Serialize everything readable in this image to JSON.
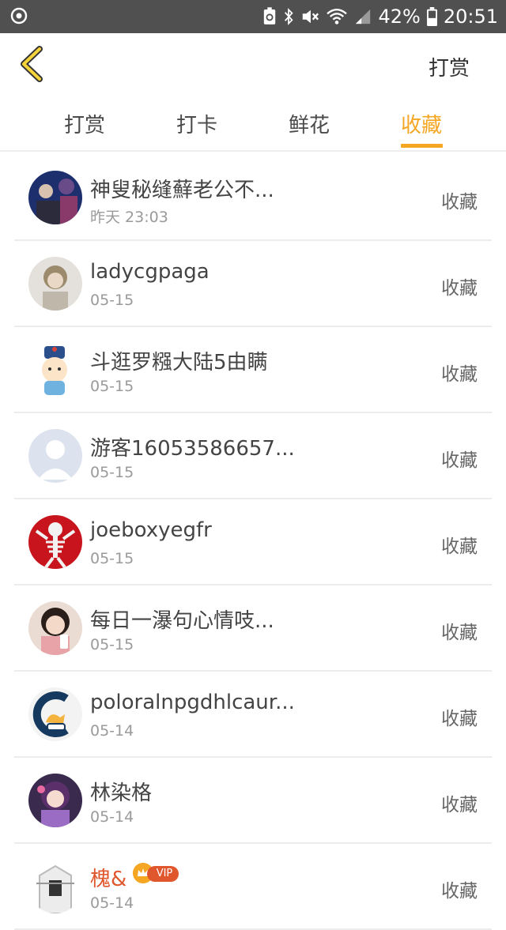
{
  "status_bar": {
    "battery": "42%",
    "time": "20:51",
    "icons": [
      "app-notification-icon",
      "battery-saver-icon",
      "bluetooth-icon",
      "mute-icon",
      "wifi-icon",
      "signal-icon",
      "battery-icon"
    ]
  },
  "header": {
    "back_icon": "chevron-left-icon",
    "action_label": "打赏"
  },
  "tabs": [
    {
      "label": "打赏",
      "active": false
    },
    {
      "label": "打卡",
      "active": false
    },
    {
      "label": "鲜花",
      "active": false
    },
    {
      "label": "收藏",
      "active": true
    }
  ],
  "colors": {
    "accent": "#f5a623",
    "vip_name": "#e0562d",
    "status_bar": "#505050"
  },
  "list": [
    {
      "name": "神叟秘缝蘚老公不...",
      "date": "昨天 23:03",
      "action": "收藏"
    },
    {
      "name": "ladycgpaga",
      "date": "05-15",
      "action": "收藏"
    },
    {
      "name": "斗逛罗糨大陆5由瞒",
      "date": "05-15",
      "action": "收藏"
    },
    {
      "name": "游客16053586657...",
      "date": "05-15",
      "action": "收藏"
    },
    {
      "name": "joeboxyegfr",
      "date": "05-15",
      "action": "收藏"
    },
    {
      "name": "每日一瀑句心情吱...",
      "date": "05-15",
      "action": "收藏"
    },
    {
      "name": "poloralnpgdhlcaur...",
      "date": "05-14",
      "action": "收藏"
    },
    {
      "name": "林染格",
      "date": "05-14",
      "action": "收藏"
    },
    {
      "name": "槐&",
      "date": "05-14",
      "action": "收藏",
      "vip_label": "VIP"
    }
  ]
}
